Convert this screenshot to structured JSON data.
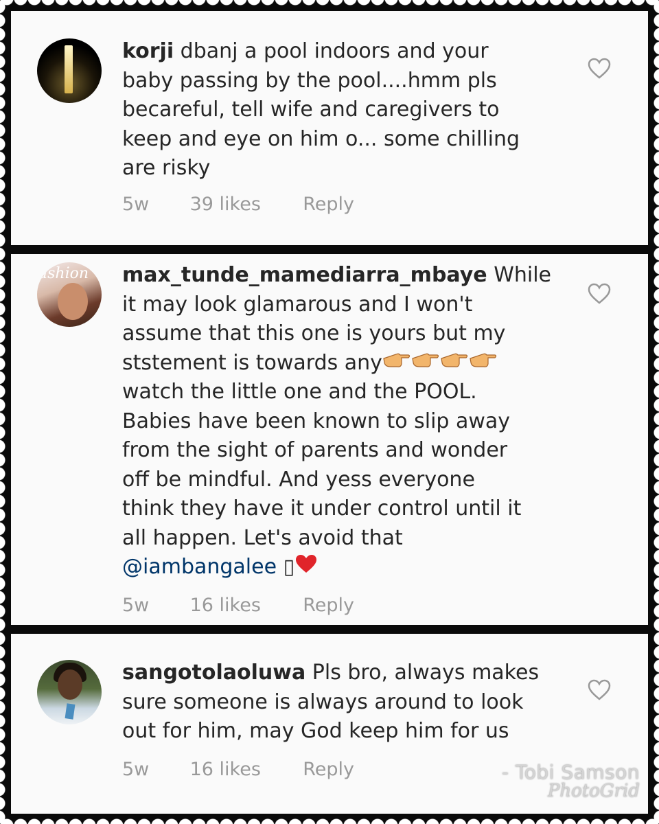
{
  "comments": [
    {
      "username": "korji",
      "text_lines": [
        "dbanj a pool indoors and your",
        "baby passing by the pool....hmm pls",
        "becareful, tell wife and caregivers to",
        "keep and eye on him o... some chilling",
        "are risky"
      ],
      "time": "5w",
      "likes": "39 likes",
      "reply": "Reply"
    },
    {
      "username": "max_tunde_mamediarra_mbaye",
      "text_first": "While",
      "text_lines": [
        "it may look glamarous and I won't",
        "assume that this one is yours but my",
        "ststement is towards any",
        "watch the little one and the POOL.",
        "Babies have been known to slip away",
        "from the sight of parents and wonder",
        "off be mindful. And yess everyone",
        "think they have it under control until it",
        "all happen. Let's avoid that"
      ],
      "mention": "@iambangalee",
      "mention_suffix": "▯",
      "emoji_icons": [
        "pointing-hand-icon",
        "pointing-hand-icon",
        "pointing-hand-icon",
        "pointing-hand-icon",
        "heart-emoji-icon"
      ],
      "time": "5w",
      "likes": "16 likes",
      "reply": "Reply"
    },
    {
      "username": "sangotolaoluwa",
      "text_first": "Pls bro, always makes",
      "text_lines": [
        "sure someone is always around to look",
        "out for him,  may God keep him for us"
      ],
      "time": "5w",
      "likes": "16 likes",
      "reply": "Reply"
    }
  ],
  "watermark": {
    "line1": "- Tobi Samson",
    "line2": "PhotoGrid"
  },
  "colors": {
    "text": "#262626",
    "meta": "#999999",
    "mention": "#003569",
    "frame": "#0a0a0a",
    "panel": "#fafafa"
  }
}
